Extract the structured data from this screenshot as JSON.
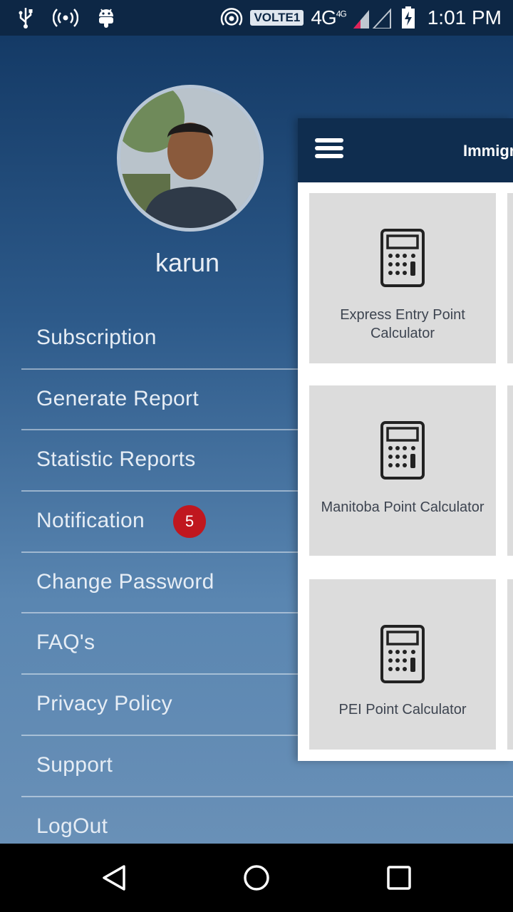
{
  "status_bar": {
    "icons_left": [
      "usb-icon",
      "hotspot-icon",
      "android-icon"
    ],
    "icons_right": [
      "wifi-calling-icon",
      "signal-icon",
      "battery-charging-icon"
    ],
    "volte": "VOLTE1",
    "network": "4G",
    "network_sup": "4G",
    "time": "1:01 PM"
  },
  "drawer": {
    "username": "karun",
    "menu": [
      {
        "label": "Subscription"
      },
      {
        "label": "Generate Report"
      },
      {
        "label": "Statistic Reports"
      },
      {
        "label": "Notification",
        "badge": "5"
      },
      {
        "label": "Change Password"
      },
      {
        "label": "FAQ's"
      },
      {
        "label": "Privacy Policy"
      },
      {
        "label": "Support"
      },
      {
        "label": "LogOut"
      }
    ],
    "colors": {
      "badge": "#c0171f"
    }
  },
  "main": {
    "toolbar_title": "Immigr",
    "cards": [
      {
        "label": "Express Entry Point Calculator",
        "icon": "calculator-icon"
      },
      {
        "label": "Manitoba Point Calculator",
        "icon": "calculator-icon"
      },
      {
        "label": "PEI Point Calculator",
        "icon": "calculator-icon"
      }
    ]
  },
  "nav_bar": {
    "buttons": [
      "back-icon",
      "home-icon",
      "recents-icon"
    ]
  }
}
